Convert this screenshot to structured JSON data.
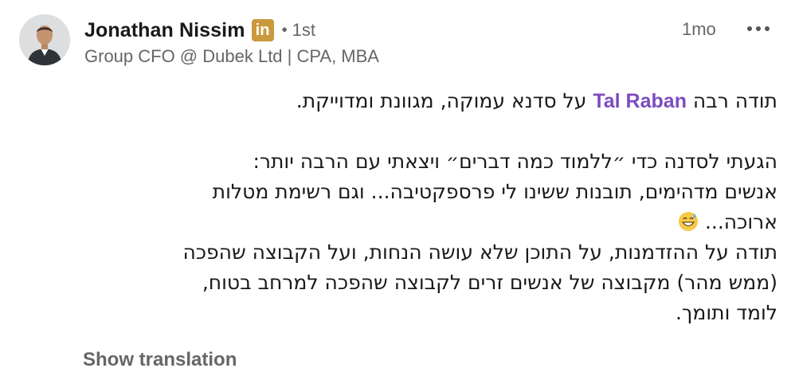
{
  "author": {
    "name": "Jonathan Nissim",
    "badge_icon": "linkedin-premium-icon",
    "badge_text": "in",
    "badge_color": "#c99a3d",
    "separator": "•",
    "degree": "1st",
    "headline": "Group CFO @ Dubek Ltd | CPA, MBA"
  },
  "post": {
    "time": "1mo",
    "more_icon": "more-options-icon",
    "line1_start": "תודה רבה",
    "mention": "Tal Raban",
    "mention_color": "#7c4cbf",
    "line1_end": "על סדנא עמוקה, מגוונת ומדוייקת.",
    "line2": "הגעתי לסדנה כדי ״ללמוד כמה דברים״ ויצאתי עם הרבה יותר:",
    "line3": "אנשים מדהימים, תובנות ששינו לי פרספקטיבה... וגם רשימת מטלות",
    "line4": "ארוכה...",
    "emoji_icon": "grinning-sweat-emoji",
    "line5": "תודה על ההזדמנות, על התוכן שלא עושה הנחות, ועל הקבוצה שהפכה",
    "line6": "(ממש מהר) מקבוצה של אנשים זרים לקבוצה שהפכה למרחב בטוח,",
    "line7": "לומד ותומך.",
    "show_translation": "Show translation"
  }
}
